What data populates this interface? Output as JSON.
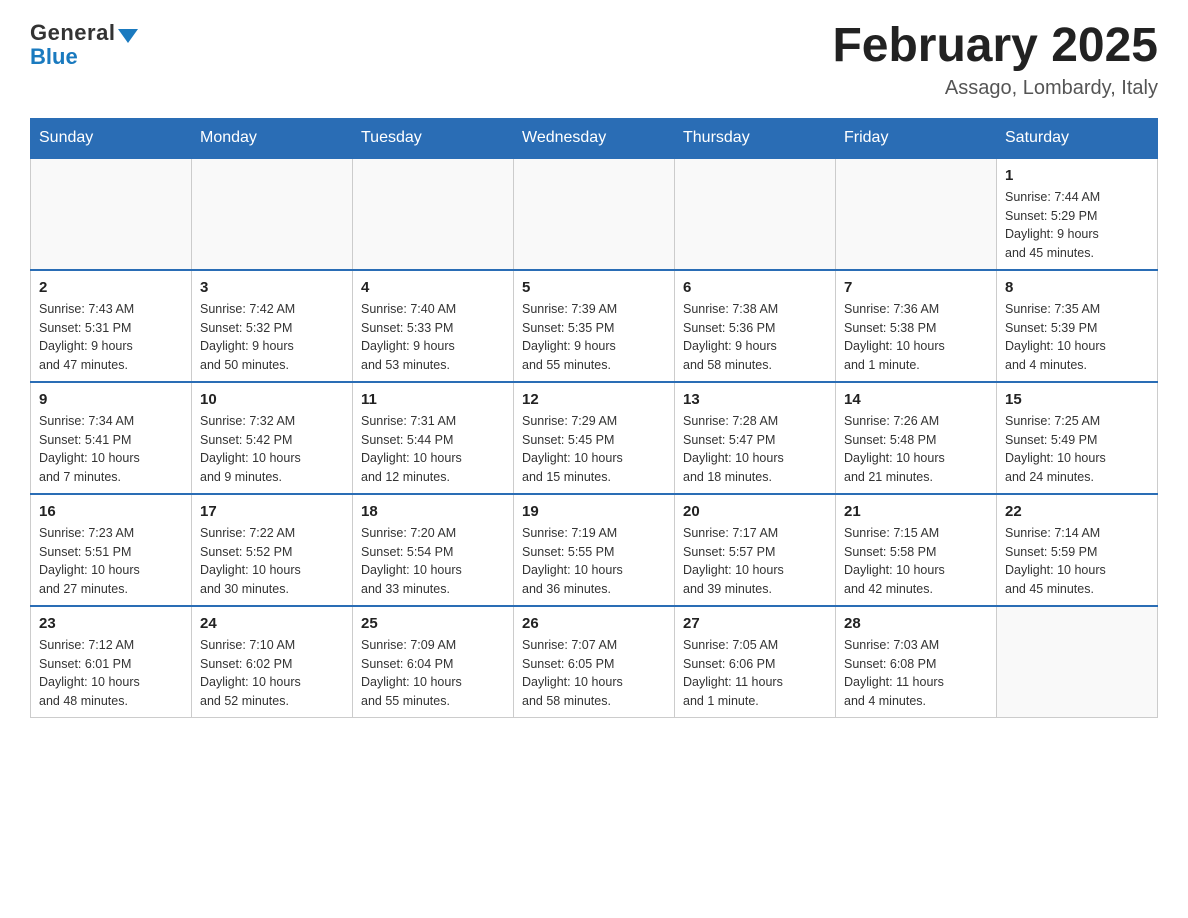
{
  "header": {
    "logo_general": "General",
    "logo_blue": "Blue",
    "month_title": "February 2025",
    "location": "Assago, Lombardy, Italy"
  },
  "weekdays": [
    "Sunday",
    "Monday",
    "Tuesday",
    "Wednesday",
    "Thursday",
    "Friday",
    "Saturday"
  ],
  "weeks": [
    [
      {
        "day": "",
        "info": ""
      },
      {
        "day": "",
        "info": ""
      },
      {
        "day": "",
        "info": ""
      },
      {
        "day": "",
        "info": ""
      },
      {
        "day": "",
        "info": ""
      },
      {
        "day": "",
        "info": ""
      },
      {
        "day": "1",
        "info": "Sunrise: 7:44 AM\nSunset: 5:29 PM\nDaylight: 9 hours\nand 45 minutes."
      }
    ],
    [
      {
        "day": "2",
        "info": "Sunrise: 7:43 AM\nSunset: 5:31 PM\nDaylight: 9 hours\nand 47 minutes."
      },
      {
        "day": "3",
        "info": "Sunrise: 7:42 AM\nSunset: 5:32 PM\nDaylight: 9 hours\nand 50 minutes."
      },
      {
        "day": "4",
        "info": "Sunrise: 7:40 AM\nSunset: 5:33 PM\nDaylight: 9 hours\nand 53 minutes."
      },
      {
        "day": "5",
        "info": "Sunrise: 7:39 AM\nSunset: 5:35 PM\nDaylight: 9 hours\nand 55 minutes."
      },
      {
        "day": "6",
        "info": "Sunrise: 7:38 AM\nSunset: 5:36 PM\nDaylight: 9 hours\nand 58 minutes."
      },
      {
        "day": "7",
        "info": "Sunrise: 7:36 AM\nSunset: 5:38 PM\nDaylight: 10 hours\nand 1 minute."
      },
      {
        "day": "8",
        "info": "Sunrise: 7:35 AM\nSunset: 5:39 PM\nDaylight: 10 hours\nand 4 minutes."
      }
    ],
    [
      {
        "day": "9",
        "info": "Sunrise: 7:34 AM\nSunset: 5:41 PM\nDaylight: 10 hours\nand 7 minutes."
      },
      {
        "day": "10",
        "info": "Sunrise: 7:32 AM\nSunset: 5:42 PM\nDaylight: 10 hours\nand 9 minutes."
      },
      {
        "day": "11",
        "info": "Sunrise: 7:31 AM\nSunset: 5:44 PM\nDaylight: 10 hours\nand 12 minutes."
      },
      {
        "day": "12",
        "info": "Sunrise: 7:29 AM\nSunset: 5:45 PM\nDaylight: 10 hours\nand 15 minutes."
      },
      {
        "day": "13",
        "info": "Sunrise: 7:28 AM\nSunset: 5:47 PM\nDaylight: 10 hours\nand 18 minutes."
      },
      {
        "day": "14",
        "info": "Sunrise: 7:26 AM\nSunset: 5:48 PM\nDaylight: 10 hours\nand 21 minutes."
      },
      {
        "day": "15",
        "info": "Sunrise: 7:25 AM\nSunset: 5:49 PM\nDaylight: 10 hours\nand 24 minutes."
      }
    ],
    [
      {
        "day": "16",
        "info": "Sunrise: 7:23 AM\nSunset: 5:51 PM\nDaylight: 10 hours\nand 27 minutes."
      },
      {
        "day": "17",
        "info": "Sunrise: 7:22 AM\nSunset: 5:52 PM\nDaylight: 10 hours\nand 30 minutes."
      },
      {
        "day": "18",
        "info": "Sunrise: 7:20 AM\nSunset: 5:54 PM\nDaylight: 10 hours\nand 33 minutes."
      },
      {
        "day": "19",
        "info": "Sunrise: 7:19 AM\nSunset: 5:55 PM\nDaylight: 10 hours\nand 36 minutes."
      },
      {
        "day": "20",
        "info": "Sunrise: 7:17 AM\nSunset: 5:57 PM\nDaylight: 10 hours\nand 39 minutes."
      },
      {
        "day": "21",
        "info": "Sunrise: 7:15 AM\nSunset: 5:58 PM\nDaylight: 10 hours\nand 42 minutes."
      },
      {
        "day": "22",
        "info": "Sunrise: 7:14 AM\nSunset: 5:59 PM\nDaylight: 10 hours\nand 45 minutes."
      }
    ],
    [
      {
        "day": "23",
        "info": "Sunrise: 7:12 AM\nSunset: 6:01 PM\nDaylight: 10 hours\nand 48 minutes."
      },
      {
        "day": "24",
        "info": "Sunrise: 7:10 AM\nSunset: 6:02 PM\nDaylight: 10 hours\nand 52 minutes."
      },
      {
        "day": "25",
        "info": "Sunrise: 7:09 AM\nSunset: 6:04 PM\nDaylight: 10 hours\nand 55 minutes."
      },
      {
        "day": "26",
        "info": "Sunrise: 7:07 AM\nSunset: 6:05 PM\nDaylight: 10 hours\nand 58 minutes."
      },
      {
        "day": "27",
        "info": "Sunrise: 7:05 AM\nSunset: 6:06 PM\nDaylight: 11 hours\nand 1 minute."
      },
      {
        "day": "28",
        "info": "Sunrise: 7:03 AM\nSunset: 6:08 PM\nDaylight: 11 hours\nand 4 minutes."
      },
      {
        "day": "",
        "info": ""
      }
    ]
  ]
}
